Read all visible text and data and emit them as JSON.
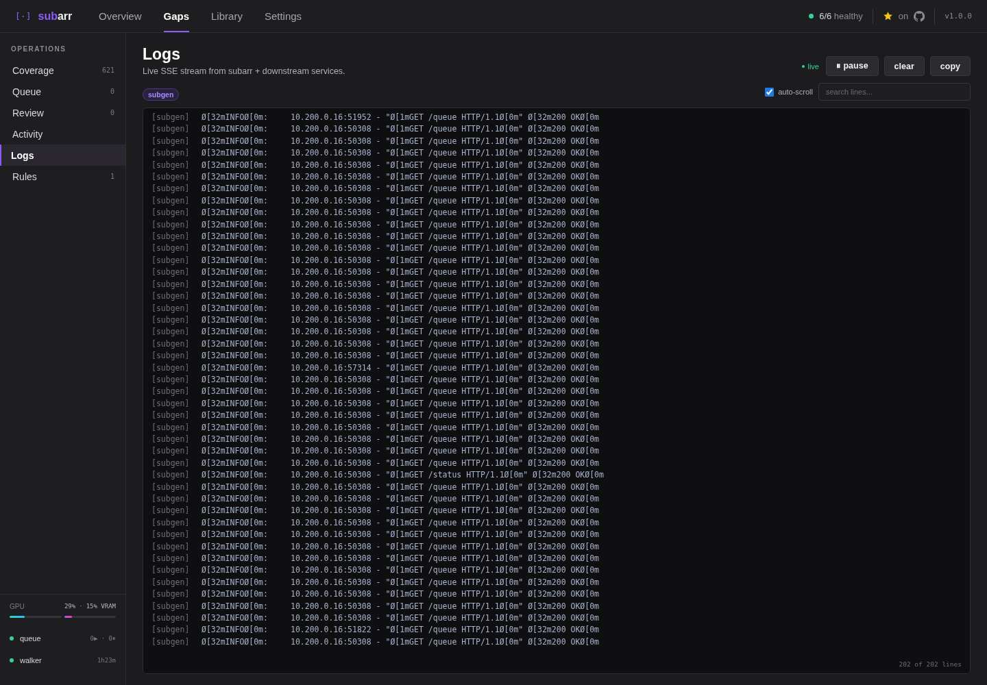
{
  "brand": {
    "icon": "[·]",
    "name_accent": "sub",
    "name_rest": "arr"
  },
  "nav": [
    {
      "label": "Overview",
      "selected": false
    },
    {
      "label": "Gaps",
      "selected": true
    },
    {
      "label": "Library",
      "selected": false
    },
    {
      "label": "Settings",
      "selected": false
    }
  ],
  "header_status": {
    "count": "6/6",
    "label": "healthy",
    "star_label": "on",
    "version": "v1.0.0"
  },
  "sidebar": {
    "section": "OPERATIONS",
    "items": [
      {
        "label": "Coverage",
        "count": "621",
        "selected": false
      },
      {
        "label": "Queue",
        "count": "0",
        "selected": false
      },
      {
        "label": "Review",
        "count": "0",
        "selected": false
      },
      {
        "label": "Activity",
        "selected": false
      },
      {
        "label": "Logs",
        "selected": true
      },
      {
        "label": "Rules",
        "count": "1",
        "selected": false
      }
    ],
    "gpu": {
      "label": "GPU",
      "gpu_reading": "29%",
      "separator": "·",
      "vram_reading": "15% VRAM",
      "meters": [
        {
          "level": 0.29
        },
        {
          "level": 0.15
        }
      ]
    },
    "workers": [
      {
        "name": "queue",
        "reading": "0▶ · 0⏸"
      },
      {
        "name": "walker",
        "reading": "1h23m"
      }
    ]
  },
  "page": {
    "title": "Logs",
    "subtitle": "Live SSE stream from subarr + downstream services.",
    "live_label": "live",
    "buttons": [
      "⏸ pause",
      "clear",
      "copy"
    ],
    "filter_tag": "subgen",
    "auto_scroll": {
      "label": "auto-scroll",
      "checked": true
    },
    "search": {
      "placeholder": "search lines..."
    }
  },
  "log": {
    "footer": "202 of 202 lines",
    "lines": [
      {
        "source": "[subgen]",
        "level": "Ø[32mINFOØ[0m:",
        "message": "10.200.0.16:51952 - \"Ø[1mGET /queue HTTP/1.1Ø[0m\" Ø[32m200 OKØ[0m"
      },
      {
        "source": "[subgen]",
        "level": "Ø[32mINFOØ[0m:",
        "message": "10.200.0.16:50308 - \"Ø[1mGET /queue HTTP/1.1Ø[0m\" Ø[32m200 OKØ[0m"
      },
      {
        "source": "[subgen]",
        "level": "Ø[32mINFOØ[0m:",
        "message": "10.200.0.16:50308 - \"Ø[1mGET /queue HTTP/1.1Ø[0m\" Ø[32m200 OKØ[0m"
      },
      {
        "source": "[subgen]",
        "level": "Ø[32mINFOØ[0m:",
        "message": "10.200.0.16:50308 - \"Ø[1mGET /queue HTTP/1.1Ø[0m\" Ø[32m200 OKØ[0m"
      },
      {
        "source": "[subgen]",
        "level": "Ø[32mINFOØ[0m:",
        "message": "10.200.0.16:50308 - \"Ø[1mGET /queue HTTP/1.1Ø[0m\" Ø[32m200 OKØ[0m"
      },
      {
        "source": "[subgen]",
        "level": "Ø[32mINFOØ[0m:",
        "message": "10.200.0.16:50308 - \"Ø[1mGET /queue HTTP/1.1Ø[0m\" Ø[32m200 OKØ[0m"
      },
      {
        "source": "[subgen]",
        "level": "Ø[32mINFOØ[0m:",
        "message": "10.200.0.16:50308 - \"Ø[1mGET /queue HTTP/1.1Ø[0m\" Ø[32m200 OKØ[0m"
      },
      {
        "source": "[subgen]",
        "level": "Ø[32mINFOØ[0m:",
        "message": "10.200.0.16:50308 - \"Ø[1mGET /queue HTTP/1.1Ø[0m\" Ø[32m200 OKØ[0m"
      },
      {
        "source": "[subgen]",
        "level": "Ø[32mINFOØ[0m:",
        "message": "10.200.0.16:50308 - \"Ø[1mGET /queue HTTP/1.1Ø[0m\" Ø[32m200 OKØ[0m"
      },
      {
        "source": "[subgen]",
        "level": "Ø[32mINFOØ[0m:",
        "message": "10.200.0.16:50308 - \"Ø[1mGET /queue HTTP/1.1Ø[0m\" Ø[32m200 OKØ[0m"
      },
      {
        "source": "[subgen]",
        "level": "Ø[32mINFOØ[0m:",
        "message": "10.200.0.16:50308 - \"Ø[1mGET /queue HTTP/1.1Ø[0m\" Ø[32m200 OKØ[0m"
      },
      {
        "source": "[subgen]",
        "level": "Ø[32mINFOØ[0m:",
        "message": "10.200.0.16:50308 - \"Ø[1mGET /queue HTTP/1.1Ø[0m\" Ø[32m200 OKØ[0m"
      },
      {
        "source": "[subgen]",
        "level": "Ø[32mINFOØ[0m:",
        "message": "10.200.0.16:50308 - \"Ø[1mGET /queue HTTP/1.1Ø[0m\" Ø[32m200 OKØ[0m"
      },
      {
        "source": "[subgen]",
        "level": "Ø[32mINFOØ[0m:",
        "message": "10.200.0.16:50308 - \"Ø[1mGET /queue HTTP/1.1Ø[0m\" Ø[32m200 OKØ[0m"
      },
      {
        "source": "[subgen]",
        "level": "Ø[32mINFOØ[0m:",
        "message": "10.200.0.16:50308 - \"Ø[1mGET /queue HTTP/1.1Ø[0m\" Ø[32m200 OKØ[0m"
      },
      {
        "source": "[subgen]",
        "level": "Ø[32mINFOØ[0m:",
        "message": "10.200.0.16:50308 - \"Ø[1mGET /queue HTTP/1.1Ø[0m\" Ø[32m200 OKØ[0m"
      },
      {
        "source": "[subgen]",
        "level": "Ø[32mINFOØ[0m:",
        "message": "10.200.0.16:50308 - \"Ø[1mGET /queue HTTP/1.1Ø[0m\" Ø[32m200 OKØ[0m"
      },
      {
        "source": "[subgen]",
        "level": "Ø[32mINFOØ[0m:",
        "message": "10.200.0.16:50308 - \"Ø[1mGET /queue HTTP/1.1Ø[0m\" Ø[32m200 OKØ[0m"
      },
      {
        "source": "[subgen]",
        "level": "Ø[32mINFOØ[0m:",
        "message": "10.200.0.16:50308 - \"Ø[1mGET /queue HTTP/1.1Ø[0m\" Ø[32m200 OKØ[0m"
      },
      {
        "source": "[subgen]",
        "level": "Ø[32mINFOØ[0m:",
        "message": "10.200.0.16:50308 - \"Ø[1mGET /queue HTTP/1.1Ø[0m\" Ø[32m200 OKØ[0m"
      },
      {
        "source": "[subgen]",
        "level": "Ø[32mINFOØ[0m:",
        "message": "10.200.0.16:50308 - \"Ø[1mGET /queue HTTP/1.1Ø[0m\" Ø[32m200 OKØ[0m"
      },
      {
        "source": "[subgen]",
        "level": "Ø[32mINFOØ[0m:",
        "message": "10.200.0.16:57314 - \"Ø[1mGET /queue HTTP/1.1Ø[0m\" Ø[32m200 OKØ[0m"
      },
      {
        "source": "[subgen]",
        "level": "Ø[32mINFOØ[0m:",
        "message": "10.200.0.16:50308 - \"Ø[1mGET /queue HTTP/1.1Ø[0m\" Ø[32m200 OKØ[0m"
      },
      {
        "source": "[subgen]",
        "level": "Ø[32mINFOØ[0m:",
        "message": "10.200.0.16:50308 - \"Ø[1mGET /queue HTTP/1.1Ø[0m\" Ø[32m200 OKØ[0m"
      },
      {
        "source": "[subgen]",
        "level": "Ø[32mINFOØ[0m:",
        "message": "10.200.0.16:50308 - \"Ø[1mGET /queue HTTP/1.1Ø[0m\" Ø[32m200 OKØ[0m"
      },
      {
        "source": "[subgen]",
        "level": "Ø[32mINFOØ[0m:",
        "message": "10.200.0.16:50308 - \"Ø[1mGET /queue HTTP/1.1Ø[0m\" Ø[32m200 OKØ[0m"
      },
      {
        "source": "[subgen]",
        "level": "Ø[32mINFOØ[0m:",
        "message": "10.200.0.16:50308 - \"Ø[1mGET /queue HTTP/1.1Ø[0m\" Ø[32m200 OKØ[0m"
      },
      {
        "source": "[subgen]",
        "level": "Ø[32mINFOØ[0m:",
        "message": "10.200.0.16:50308 - \"Ø[1mGET /queue HTTP/1.1Ø[0m\" Ø[32m200 OKØ[0m"
      },
      {
        "source": "[subgen]",
        "level": "Ø[32mINFOØ[0m:",
        "message": "10.200.0.16:50308 - \"Ø[1mGET /queue HTTP/1.1Ø[0m\" Ø[32m200 OKØ[0m"
      },
      {
        "source": "[subgen]",
        "level": "Ø[32mINFOØ[0m:",
        "message": "10.200.0.16:50308 - \"Ø[1mGET /queue HTTP/1.1Ø[0m\" Ø[32m200 OKØ[0m"
      },
      {
        "source": "[subgen]",
        "level": "Ø[32mINFOØ[0m:",
        "message": "10.200.0.16:50308 - \"Ø[1mGET /status HTTP/1.1Ø[0m\" Ø[32m200 OKØ[0m"
      },
      {
        "source": "[subgen]",
        "level": "Ø[32mINFOØ[0m:",
        "message": "10.200.0.16:50308 - \"Ø[1mGET /queue HTTP/1.1Ø[0m\" Ø[32m200 OKØ[0m"
      },
      {
        "source": "[subgen]",
        "level": "Ø[32mINFOØ[0m:",
        "message": "10.200.0.16:50308 - \"Ø[1mGET /queue HTTP/1.1Ø[0m\" Ø[32m200 OKØ[0m"
      },
      {
        "source": "[subgen]",
        "level": "Ø[32mINFOØ[0m:",
        "message": "10.200.0.16:50308 - \"Ø[1mGET /queue HTTP/1.1Ø[0m\" Ø[32m200 OKØ[0m"
      },
      {
        "source": "[subgen]",
        "level": "Ø[32mINFOØ[0m:",
        "message": "10.200.0.16:50308 - \"Ø[1mGET /queue HTTP/1.1Ø[0m\" Ø[32m200 OKØ[0m"
      },
      {
        "source": "[subgen]",
        "level": "Ø[32mINFOØ[0m:",
        "message": "10.200.0.16:50308 - \"Ø[1mGET /queue HTTP/1.1Ø[0m\" Ø[32m200 OKØ[0m"
      },
      {
        "source": "[subgen]",
        "level": "Ø[32mINFOØ[0m:",
        "message": "10.200.0.16:50308 - \"Ø[1mGET /queue HTTP/1.1Ø[0m\" Ø[32m200 OKØ[0m"
      },
      {
        "source": "[subgen]",
        "level": "Ø[32mINFOØ[0m:",
        "message": "10.200.0.16:50308 - \"Ø[1mGET /queue HTTP/1.1Ø[0m\" Ø[32m200 OKØ[0m"
      },
      {
        "source": "[subgen]",
        "level": "Ø[32mINFOØ[0m:",
        "message": "10.200.0.16:50308 - \"Ø[1mGET /queue HTTP/1.1Ø[0m\" Ø[32m200 OKØ[0m"
      },
      {
        "source": "[subgen]",
        "level": "Ø[32mINFOØ[0m:",
        "message": "10.200.0.16:50308 - \"Ø[1mGET /queue HTTP/1.1Ø[0m\" Ø[32m200 OKØ[0m"
      },
      {
        "source": "[subgen]",
        "level": "Ø[32mINFOØ[0m:",
        "message": "10.200.0.16:50308 - \"Ø[1mGET /queue HTTP/1.1Ø[0m\" Ø[32m200 OKØ[0m"
      },
      {
        "source": "[subgen]",
        "level": "Ø[32mINFOØ[0m:",
        "message": "10.200.0.16:50308 - \"Ø[1mGET /queue HTTP/1.1Ø[0m\" Ø[32m200 OKØ[0m"
      },
      {
        "source": "[subgen]",
        "level": "Ø[32mINFOØ[0m:",
        "message": "10.200.0.16:50308 - \"Ø[1mGET /queue HTTP/1.1Ø[0m\" Ø[32m200 OKØ[0m"
      },
      {
        "source": "[subgen]",
        "level": "Ø[32mINFOØ[0m:",
        "message": "10.200.0.16:51822 - \"Ø[1mGET /queue HTTP/1.1Ø[0m\" Ø[32m200 OKØ[0m"
      },
      {
        "source": "[subgen]",
        "level": "Ø[32mINFOØ[0m:",
        "message": "10.200.0.16:50308 - \"Ø[1mGET /queue HTTP/1.1Ø[0m\" Ø[32m200 OKØ[0m"
      }
    ]
  }
}
